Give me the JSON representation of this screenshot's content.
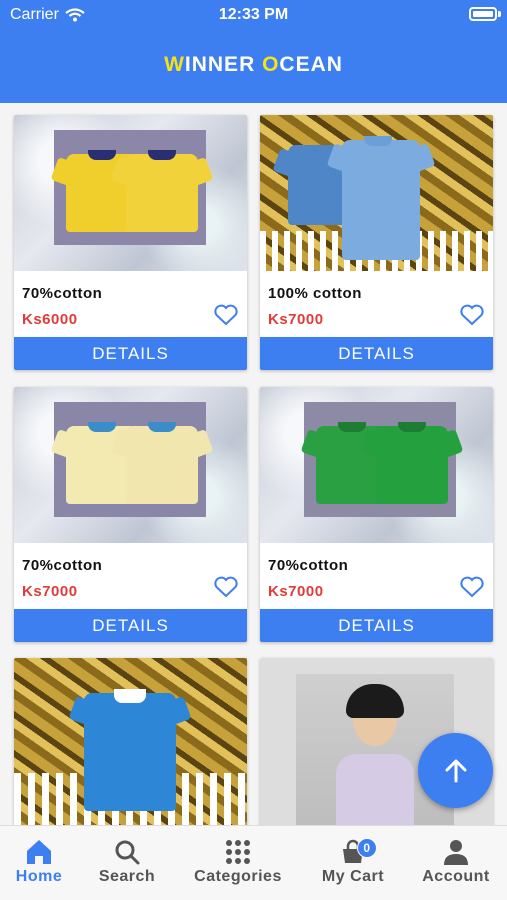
{
  "status_bar": {
    "carrier": "Carrier",
    "time": "12:33 PM"
  },
  "header": {
    "title_first_letter": "W",
    "title_part1": "INNER ",
    "title_o": "O",
    "title_part2": "CEAN"
  },
  "products": [
    {
      "title": "70%cotton",
      "price": "Ks6000",
      "button": "DETAILS"
    },
    {
      "title": "100% cotton",
      "price": "Ks7000",
      "button": "DETAILS"
    },
    {
      "title": "70%cotton",
      "price": "Ks7000",
      "button": "DETAILS"
    },
    {
      "title": "70%cotton",
      "price": "Ks7000",
      "button": "DETAILS"
    },
    {
      "title": "",
      "price": "",
      "button": ""
    },
    {
      "title": "",
      "price": "",
      "button": ""
    }
  ],
  "colors": {
    "primary": "#3d7ff0",
    "price": "#e33a3a",
    "brand_accent": "#f4e21a"
  },
  "nav": {
    "home": "Home",
    "search": "Search",
    "categories": "Categories",
    "cart": "My Cart",
    "cart_count": "0",
    "account": "Account"
  },
  "icons": {
    "wifi": "wifi-icon",
    "fav": "heart-icon",
    "fab": "arrow-up-icon",
    "home": "home-icon",
    "search": "search-icon",
    "categories": "grid-icon",
    "cart": "shopping-bag-icon",
    "account": "person-icon"
  }
}
